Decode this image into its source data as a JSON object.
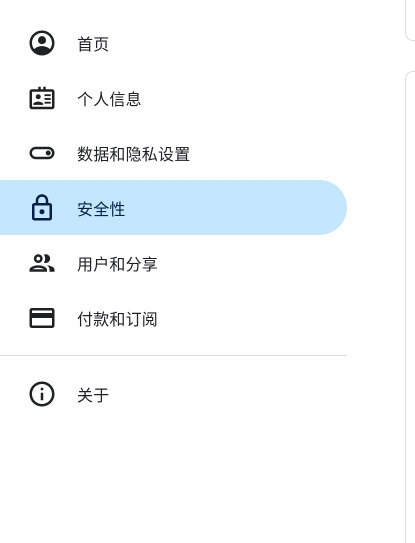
{
  "nav": {
    "items": [
      {
        "label": "首页",
        "icon": "home-account-icon",
        "selected": false
      },
      {
        "label": "个人信息",
        "icon": "id-card-icon",
        "selected": false
      },
      {
        "label": "数据和隐私设置",
        "icon": "toggle-icon",
        "selected": false
      },
      {
        "label": "安全性",
        "icon": "lock-icon",
        "selected": true
      },
      {
        "label": "用户和分享",
        "icon": "people-icon",
        "selected": false
      },
      {
        "label": "付款和订阅",
        "icon": "credit-card-icon",
        "selected": false
      }
    ],
    "about": {
      "label": "关于",
      "icon": "info-icon"
    }
  },
  "colors": {
    "selected_bg": "#c2e7ff",
    "selected_text": "#041e49",
    "divider": "#dadce0"
  }
}
